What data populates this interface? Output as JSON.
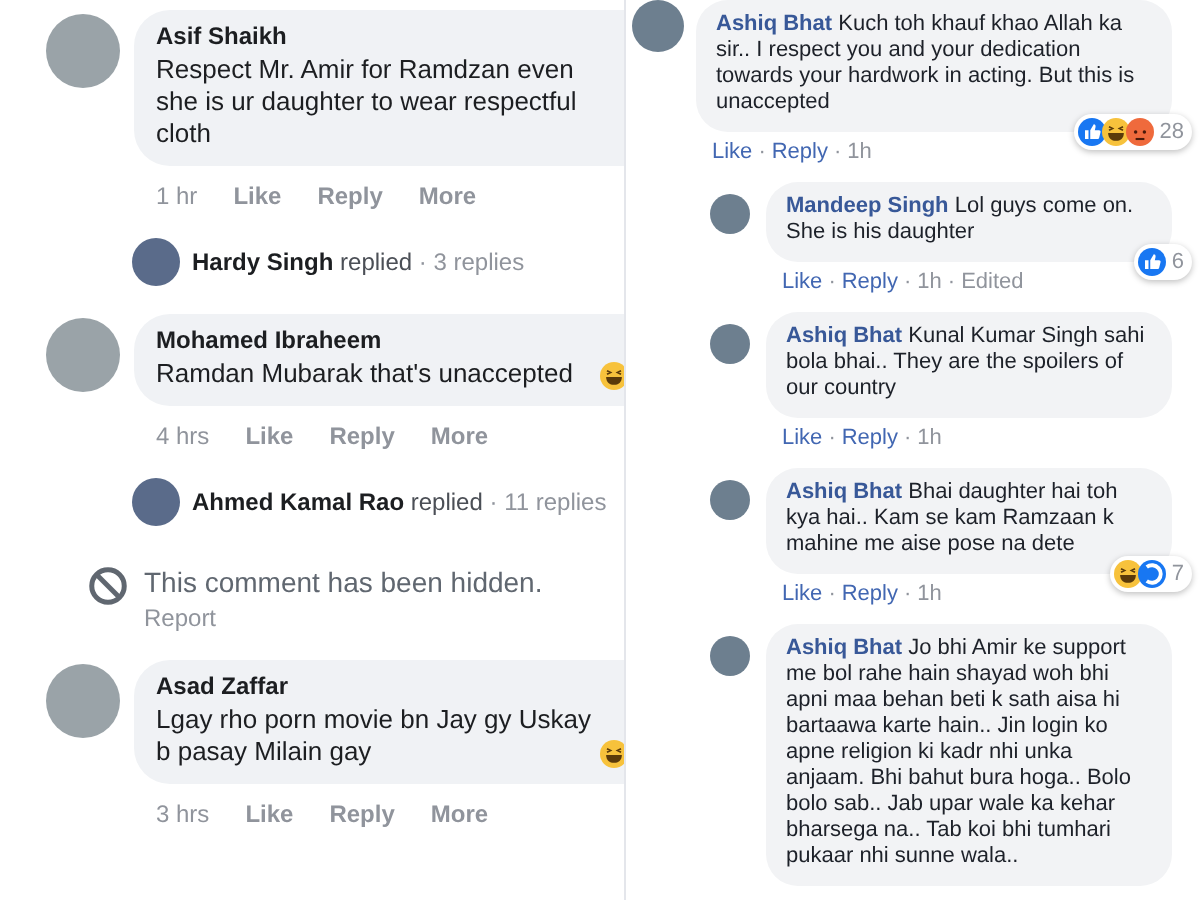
{
  "left_thread": [
    {
      "kind": "comment",
      "name": "Asif Shaikh",
      "text": "Respect Mr. Amir for Ramdzan even she is ur daughter to wear respectful cloth",
      "time": "1 hr",
      "actions": [
        "Like",
        "Reply",
        "More"
      ],
      "reacted": false
    },
    {
      "kind": "replies",
      "name": "Hardy Singh",
      "verb": "replied",
      "count": "· 3 replies"
    },
    {
      "kind": "comment",
      "name": "Mohamed Ibraheem",
      "text": "Ramdan Mubarak that's unaccepted",
      "time": "4 hrs",
      "actions": [
        "Like",
        "Reply",
        "More"
      ],
      "reacted": true
    },
    {
      "kind": "replies",
      "name": "Ahmed Kamal Rao",
      "verb": "replied",
      "count": "· 11 replies"
    },
    {
      "kind": "hidden",
      "text": "This comment has been hidden.",
      "link": "Report"
    },
    {
      "kind": "comment",
      "name": "Asad Zaffar",
      "text": "Lgay rho porn movie bn Jay gy Uskay b pasay Milain gay",
      "time": "3 hrs",
      "actions": [
        "Like",
        "Reply",
        "More"
      ],
      "reacted": true
    }
  ],
  "right_thread": [
    {
      "name": "Ashiq Bhat",
      "text": "Kuch toh khauf khao Allah ka sir.. I respect you and your dedication towards your hardwork in acting. But this is unaccepted",
      "actions": [
        {
          "kind": "link",
          "text": "Like"
        },
        {
          "kind": "dot",
          "text": "·"
        },
        {
          "kind": "link",
          "text": "Reply"
        },
        {
          "kind": "dot",
          "text": "·"
        },
        {
          "kind": "time",
          "text": "1h"
        }
      ],
      "reactions": {
        "types": [
          {
            "kind": "like"
          },
          {
            "kind": "haha"
          },
          {
            "kind": "angry"
          }
        ],
        "count": "28"
      },
      "children": [
        {
          "name": "Mandeep Singh",
          "text": "Lol guys come on. She is his daughter",
          "actions": [
            {
              "kind": "link",
              "text": "Like"
            },
            {
              "kind": "dot",
              "text": "·"
            },
            {
              "kind": "link",
              "text": "Reply"
            },
            {
              "kind": "dot",
              "text": "·"
            },
            {
              "kind": "time",
              "text": "1h"
            },
            {
              "kind": "dot",
              "text": "·"
            },
            {
              "kind": "time",
              "text": "Edited"
            }
          ],
          "reactions": {
            "types": [
              {
                "kind": "like"
              }
            ],
            "count": "6"
          }
        },
        {
          "name": "Ashiq Bhat",
          "text": "Kunal Kumar Singh sahi bola bhai.. They are the spoilers of our country",
          "actions": [
            {
              "kind": "link",
              "text": "Like"
            },
            {
              "kind": "dot",
              "text": "·"
            },
            {
              "kind": "link",
              "text": "Reply"
            },
            {
              "kind": "dot",
              "text": "·"
            },
            {
              "kind": "time",
              "text": "1h"
            }
          ]
        },
        {
          "name": "Ashiq Bhat",
          "text": "Bhai daughter hai toh kya hai.. Kam se kam Ramzaan k mahine me aise pose na dete",
          "actions": [
            {
              "kind": "link",
              "text": "Like"
            },
            {
              "kind": "dot",
              "text": "·"
            },
            {
              "kind": "link",
              "text": "Reply"
            },
            {
              "kind": "dot",
              "text": "·"
            },
            {
              "kind": "time",
              "text": "1h"
            }
          ],
          "reactions": {
            "types": [
              {
                "kind": "haha"
              },
              {
                "kind": "wow"
              }
            ],
            "count": "7"
          }
        },
        {
          "name": "Ashiq Bhat",
          "text": "Jo bhi Amir ke support me bol rahe hain shayad woh bhi apni maa behan beti k sath aisa hi bartaawa karte hain.. Jin login ko apne religion ki kadr nhi unka anjaam. Bhi bahut bura hoga.. Bolo bolo sab.. Jab upar wale ka kehar bharsega na.. Tab koi bhi tumhari pukaar nhi sunne wala.."
        }
      ]
    }
  ]
}
